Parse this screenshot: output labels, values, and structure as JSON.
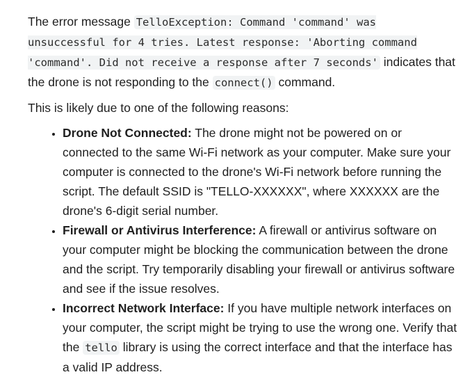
{
  "intro": {
    "prefix": "The error message ",
    "error_code": "TelloException: Command 'command' was unsuccessful for 4 tries. Latest response: 'Aborting command 'command'. Did not receive a response after 7 seconds'",
    "middle": " indicates that the drone is not responding to the ",
    "connect_code": "connect()",
    "suffix": " command."
  },
  "reasons_intro": "This is likely due to one of the following reasons:",
  "reasons": [
    {
      "title": "Drone Not Connected:",
      "text": " The drone might not be powered on or connected to the same Wi-Fi network as your computer. Make sure your computer is connected to the drone's Wi-Fi network before running the script. The default SSID is \"TELLO-XXXXXX\", where XXXXXX are the drone's 6-digit serial number."
    },
    {
      "title": "Firewall or Antivirus Interference:",
      "text": " A firewall or antivirus software on your computer might be blocking the communication between the drone and the script. Try temporarily disabling your firewall or antivirus software and see if the issue resolves."
    },
    {
      "title": "Incorrect Network Interface:",
      "text_before": " If you have multiple network interfaces on your computer, the script might be trying to use the wrong one. Verify that the ",
      "code": "tello",
      "text_after": " library is using the correct interface and that the interface has a valid IP address."
    }
  ]
}
